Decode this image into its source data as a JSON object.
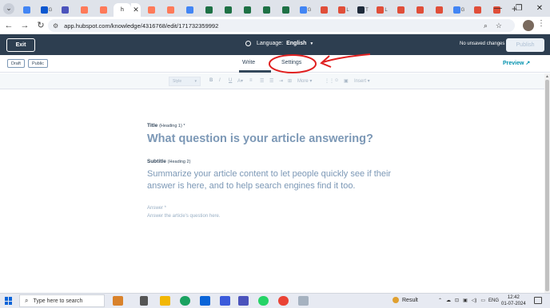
{
  "browser": {
    "tabs": [
      {
        "label": "",
        "color": "#4285f4"
      },
      {
        "label": "G",
        "color": "#0b57d0"
      },
      {
        "label": "",
        "color": "#4b53bc"
      },
      {
        "label": "",
        "color": "#ff7a59"
      },
      {
        "label": "",
        "color": "#ff7a59"
      },
      {
        "label": "",
        "color": "#ff7a59"
      },
      {
        "label": "",
        "color": "#ff7a59"
      },
      {
        "label": "",
        "color": "#4285f4"
      },
      {
        "label": "",
        "color": "#1e7145"
      },
      {
        "label": "",
        "color": "#1e7145"
      },
      {
        "label": "",
        "color": "#1e7145"
      },
      {
        "label": "",
        "color": "#1e7145"
      },
      {
        "label": "",
        "color": "#1e7145"
      },
      {
        "label": "G",
        "color": "#4285f4"
      },
      {
        "label": "",
        "color": "#e04e39"
      },
      {
        "label": "L",
        "color": "#e04e39"
      },
      {
        "label": "T",
        "color": "#1e2a3a"
      },
      {
        "label": "L",
        "color": "#e04e39"
      },
      {
        "label": "",
        "color": "#e04e39"
      },
      {
        "label": "",
        "color": "#e04e39"
      },
      {
        "label": "",
        "color": "#e04e39"
      },
      {
        "label": "G",
        "color": "#4285f4"
      },
      {
        "label": "",
        "color": "#e04e39"
      },
      {
        "label": "",
        "color": "#e04e39"
      }
    ],
    "active_tab_label": "h",
    "new_tab": "+",
    "url": "app.hubspot.com/knowledge/4316768/edit/171732359992"
  },
  "editor": {
    "exit_label": "Exit",
    "language_label": "Language:",
    "language_value": "English",
    "unsaved_label": "No unsaved changes",
    "publish_label": "Publish",
    "draft_label": "Draft",
    "public_label": "Public",
    "tab_write": "Write",
    "tab_settings": "Settings",
    "preview_label": "Preview",
    "toolbar": {
      "style_label": "Style",
      "more_label": "More",
      "insert_label": "Insert"
    },
    "title_label": "Title",
    "title_hint": "(Heading 1) *",
    "title_placeholder": "What question is your article answering?",
    "subtitle_label": "Subtitle",
    "subtitle_hint": "(Heading 2)",
    "subtitle_placeholder": "Summarize your article content to let people quickly see if their answer is here, and to help search engines find it too.",
    "answer_label": "Answer *",
    "answer_placeholder": "Answer the article's question here."
  },
  "taskbar": {
    "search_placeholder": "Type here to search",
    "weather": "Result",
    "language": "ENG",
    "time": "12:42",
    "date": "01-07-2024"
  },
  "colors": {
    "header_bg": "#2d3e50",
    "accent": "#0091ae",
    "annotation": "#e02020"
  }
}
